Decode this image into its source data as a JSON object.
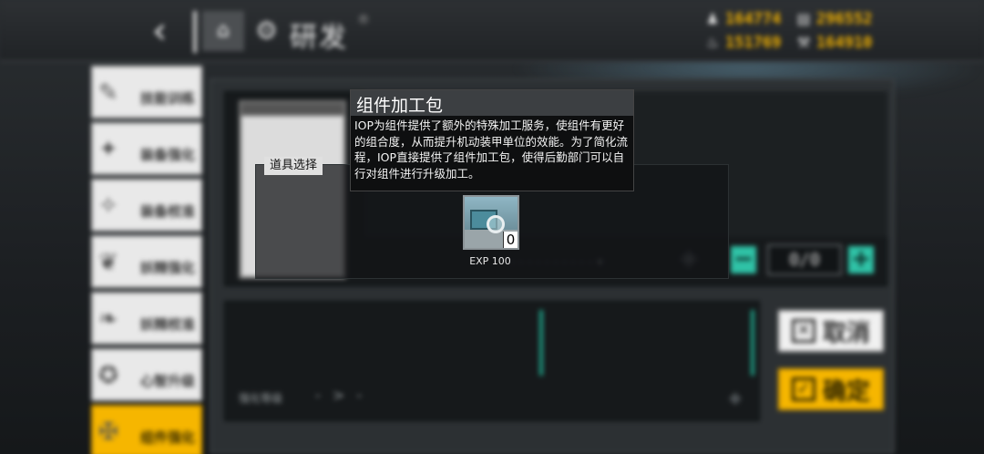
{
  "header": {
    "back_glyph": "‹",
    "home_icon": "home-icon",
    "module_title": "研发",
    "module_mark": "®",
    "resources": [
      {
        "name": "manpower",
        "icon": "manpower-icon",
        "value": "164774"
      },
      {
        "name": "ammo",
        "icon": "ammo-icon",
        "value": "296552"
      },
      {
        "name": "rations",
        "icon": "rations-icon",
        "value": "151769"
      },
      {
        "name": "parts",
        "icon": "parts-icon",
        "value": "164910"
      }
    ]
  },
  "menu": {
    "items": [
      {
        "label": "技能训练",
        "icon": "training-icon"
      },
      {
        "label": "装备强化",
        "icon": "equipment-enhance-icon"
      },
      {
        "label": "装备校准",
        "icon": "equipment-calibrate-icon"
      },
      {
        "label": "妖精强化",
        "icon": "fairy-enhance-icon"
      },
      {
        "label": "妖精校准",
        "icon": "fairy-calibrate-icon"
      },
      {
        "label": "心智升级",
        "icon": "neural-upgrade-icon"
      },
      {
        "label": "组件强化",
        "icon": "component-enhance-icon"
      }
    ],
    "active_index": 6
  },
  "panel": {
    "count_value": "0/0",
    "minus_label": "−",
    "plus_label": "+",
    "level_label": "强化等级",
    "level_arrow": "- > -",
    "cancel_label": "取消",
    "confirm_label": "确定"
  },
  "overlay": {
    "tag_label": "道具选择",
    "tooltip_title": "组件加工包",
    "tooltip_body": "IOP为组件提供了额外的特殊加工服务，使组件有更好的组合度，从而提升机动装甲单位的效能。为了简化流程，IOP直接提供了组件加工包，使得后勤部门可以自行对组件进行升级加工。",
    "item": {
      "name": "组件加工包",
      "icon": "component-kit-icon",
      "count": "0",
      "exp_label": "EXP 100"
    }
  }
}
